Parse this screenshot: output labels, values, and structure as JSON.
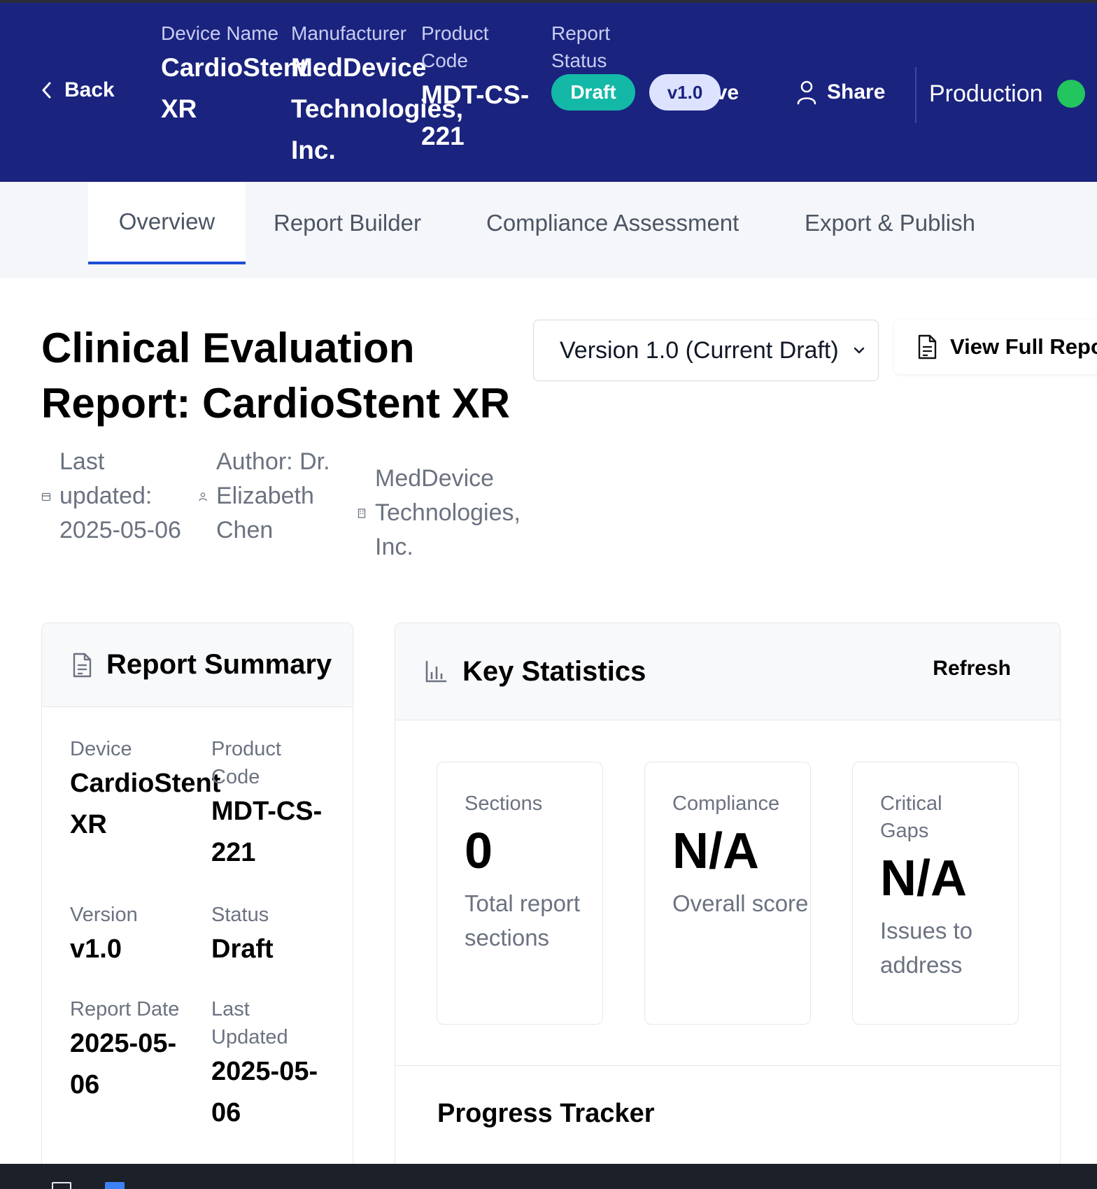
{
  "header": {
    "back_label": "Back",
    "device_name_label": "Device Name",
    "device_name": "CardioStent XR",
    "manufacturer_label": "Manufacturer",
    "manufacturer": "MedDevice Technologies, Inc.",
    "product_code_label": "Product Code",
    "product_code": "MDT-CS-221",
    "report_status_label": "Report Status",
    "status_badge": "Draft",
    "version_badge": "v1.0",
    "save_label": "Save",
    "share_label": "Share",
    "environment": "Production",
    "environment_status_color": "#22c55e",
    "background_color": "#1a237e"
  },
  "tabs": [
    {
      "label": "Overview",
      "active": true
    },
    {
      "label": "Report Builder",
      "active": false
    },
    {
      "label": "Compliance Assessment",
      "active": false
    },
    {
      "label": "Export & Publish",
      "active": false
    }
  ],
  "main": {
    "title": "Clinical Evaluation Report: CardioStent XR",
    "version_select": "Version 1.0 (Current Draft)",
    "view_full_report": "View Full Report",
    "meta": {
      "updated": "Last updated: 2025-05-06",
      "author": "Author: Dr. Elizabeth Chen",
      "organization": "MedDevice Technologies, Inc."
    }
  },
  "summary": {
    "title": "Report Summary",
    "fields": [
      {
        "label": "Device",
        "value": "CardioStent XR"
      },
      {
        "label": "Product Code",
        "value": "MDT-CS-221"
      },
      {
        "label": "Version",
        "value": "v1.0"
      },
      {
        "label": "Status",
        "value": "Draft"
      },
      {
        "label": "Report Date",
        "value": "2025-05-06"
      },
      {
        "label": "Last Updated",
        "value": "2025-05-06"
      }
    ]
  },
  "stats": {
    "title": "Key Statistics",
    "refresh_label": "Refresh",
    "cards": [
      {
        "label": "Sections",
        "value": "0",
        "sub": "Total report sections"
      },
      {
        "label": "Compliance",
        "value": "N/A",
        "sub": "Overall score"
      },
      {
        "label": "Critical Gaps",
        "value": "N/A",
        "sub": "Issues to address"
      }
    ],
    "progress_title": "Progress Tracker"
  },
  "icons": {
    "back": "chevron-left-icon",
    "save": "save-icon",
    "share": "user-icon",
    "view_full": "file-text-icon",
    "select": "chevron-down-icon",
    "updated": "calendar-icon",
    "author": "user-icon",
    "organization": "building-icon",
    "summary": "file-text-icon",
    "stats": "bar-chart-icon"
  }
}
